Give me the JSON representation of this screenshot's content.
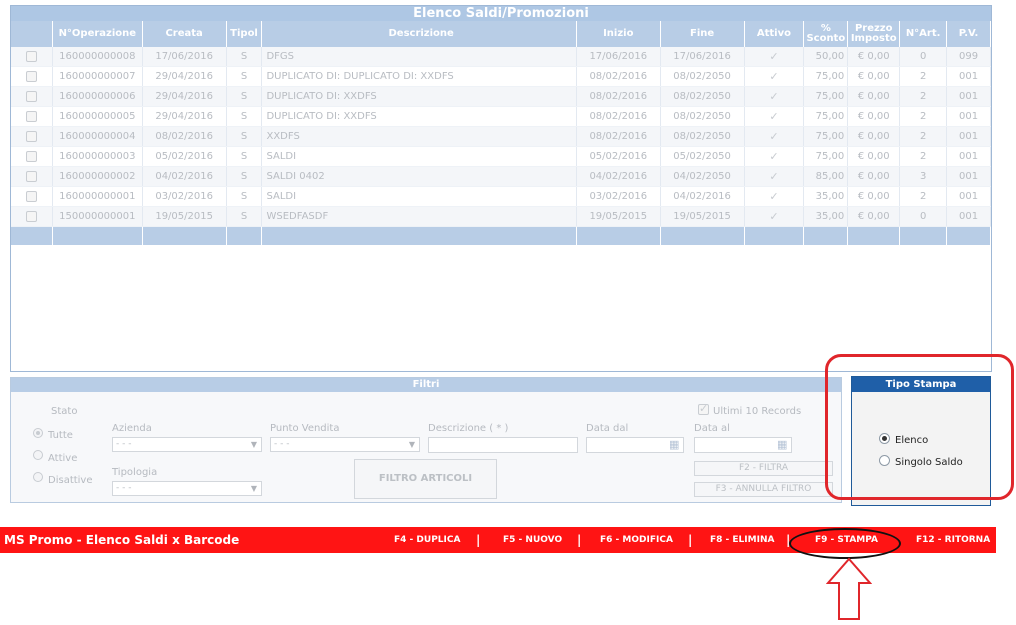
{
  "list": {
    "title": "Elenco Saldi/Promozioni",
    "columns": [
      "",
      "N°Operazione",
      "Creata",
      "Tipol",
      "Descrizione",
      "Inizio",
      "Fine",
      "Attivo",
      "% Sconto",
      "Prezzo Imposto",
      "N°Art.",
      "P.V."
    ],
    "rows": [
      {
        "op": "160000000008",
        "creata": "17/06/2016",
        "tipol": "S",
        "desc": "DFGS",
        "inizio": "17/06/2016",
        "fine": "17/06/2016",
        "sconto": "50,00",
        "prezzo": "€ 0,00",
        "art": "0",
        "pv": "099"
      },
      {
        "op": "160000000007",
        "creata": "29/04/2016",
        "tipol": "S",
        "desc": "DUPLICATO DI: DUPLICATO DI: XXDFS",
        "inizio": "08/02/2016",
        "fine": "08/02/2050",
        "sconto": "75,00",
        "prezzo": "€ 0,00",
        "art": "2",
        "pv": "001"
      },
      {
        "op": "160000000006",
        "creata": "29/04/2016",
        "tipol": "S",
        "desc": "DUPLICATO DI: XXDFS",
        "inizio": "08/02/2016",
        "fine": "08/02/2050",
        "sconto": "75,00",
        "prezzo": "€ 0,00",
        "art": "2",
        "pv": "001"
      },
      {
        "op": "160000000005",
        "creata": "29/04/2016",
        "tipol": "S",
        "desc": "DUPLICATO DI: XXDFS",
        "inizio": "08/02/2016",
        "fine": "08/02/2050",
        "sconto": "75,00",
        "prezzo": "€ 0,00",
        "art": "2",
        "pv": "001"
      },
      {
        "op": "160000000004",
        "creata": "08/02/2016",
        "tipol": "S",
        "desc": "XXDFS",
        "inizio": "08/02/2016",
        "fine": "08/02/2050",
        "sconto": "75,00",
        "prezzo": "€ 0,00",
        "art": "2",
        "pv": "001"
      },
      {
        "op": "160000000003",
        "creata": "05/02/2016",
        "tipol": "S",
        "desc": "SALDI",
        "inizio": "05/02/2016",
        "fine": "05/02/2050",
        "sconto": "75,00",
        "prezzo": "€ 0,00",
        "art": "2",
        "pv": "001"
      },
      {
        "op": "160000000002",
        "creata": "04/02/2016",
        "tipol": "S",
        "desc": "SALDI 0402",
        "inizio": "04/02/2016",
        "fine": "04/02/2050",
        "sconto": "85,00",
        "prezzo": "€ 0,00",
        "art": "3",
        "pv": "001"
      },
      {
        "op": "160000000001",
        "creata": "03/02/2016",
        "tipol": "S",
        "desc": "SALDI",
        "inizio": "03/02/2016",
        "fine": "04/02/2016",
        "sconto": "35,00",
        "prezzo": "€ 0,00",
        "art": "2",
        "pv": "001"
      },
      {
        "op": "150000000001",
        "creata": "19/05/2015",
        "tipol": "S",
        "desc": "WSEDFASDF",
        "inizio": "19/05/2015",
        "fine": "19/05/2015",
        "sconto": "35,00",
        "prezzo": "€ 0,00",
        "art": "0",
        "pv": "001"
      }
    ]
  },
  "filters": {
    "title": "Filtri",
    "stato_label": "Stato",
    "stato_options": [
      "Tutte",
      "Attive",
      "Disattive"
    ],
    "azienda_label": "Azienda",
    "azienda_value": "- - -",
    "punto_vendita_label": "Punto Vendita",
    "punto_vendita_value": "- - -",
    "descrizione_label": "Descrizione ( * )",
    "data_dal_label": "Data dal",
    "data_al_label": "Data al",
    "tipologia_label": "Tipologia",
    "tipologia_value": "- - -",
    "ultimi_label": "Ultimi 10 Records",
    "filtro_articoli": "FILTRO ARTICOLI",
    "f2_filtra": "F2 - FILTRA",
    "f3_annulla": "F3 - ANNULLA FILTRO"
  },
  "tipo_stampa": {
    "title": "Tipo Stampa",
    "options": [
      "Elenco",
      "Singolo Saldo"
    ]
  },
  "bar": {
    "title": "MS Promo - Elenco Saldi x Barcode",
    "keys": [
      "F4 - DUPLICA",
      "F5 - NUOVO",
      "F6 - MODIFICA",
      "F8 - ELIMINA",
      "F9 - STAMPA",
      "F12 - RITORNA"
    ],
    "separator": "|"
  },
  "colors": {
    "bar": "#ff1414",
    "header": "#b8cde6",
    "tipo_header": "#1f5fa8",
    "annotation_red": "#e0262b"
  }
}
